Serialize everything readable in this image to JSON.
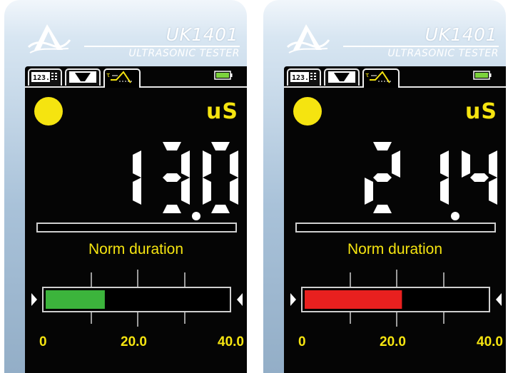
{
  "devices": [
    {
      "model": "UK1401",
      "subtitle": "ULTRASONIC TESTER",
      "unit": "uS",
      "reading": "13.0",
      "parameter_label": "Norm duration",
      "scale": {
        "min": "0",
        "mid": "20.0",
        "max": "40.0"
      },
      "progress": {
        "fraction": 0.325,
        "color": "#3cb43c"
      },
      "status_color": "#f5e410",
      "tabs": [
        {
          "icon": "numeric-display-icon"
        },
        {
          "icon": "waveform-icon"
        },
        {
          "icon": "pulse-timing-icon",
          "active": true
        }
      ]
    },
    {
      "model": "UK1401",
      "subtitle": "ULTRASONIC TESTER",
      "unit": "uS",
      "reading": "21.4",
      "parameter_label": "Norm duration",
      "scale": {
        "min": "0",
        "mid": "20.0",
        "max": "40.0"
      },
      "progress": {
        "fraction": 0.535,
        "color": "#e8201f"
      },
      "status_color": "#f5e410",
      "tabs": [
        {
          "icon": "numeric-display-icon"
        },
        {
          "icon": "waveform-icon"
        },
        {
          "icon": "pulse-timing-icon",
          "active": true
        }
      ]
    }
  ],
  "colors": {
    "accent_yellow": "#f5e410",
    "screen_background": "#050505",
    "digit_white": "#ffffff"
  }
}
